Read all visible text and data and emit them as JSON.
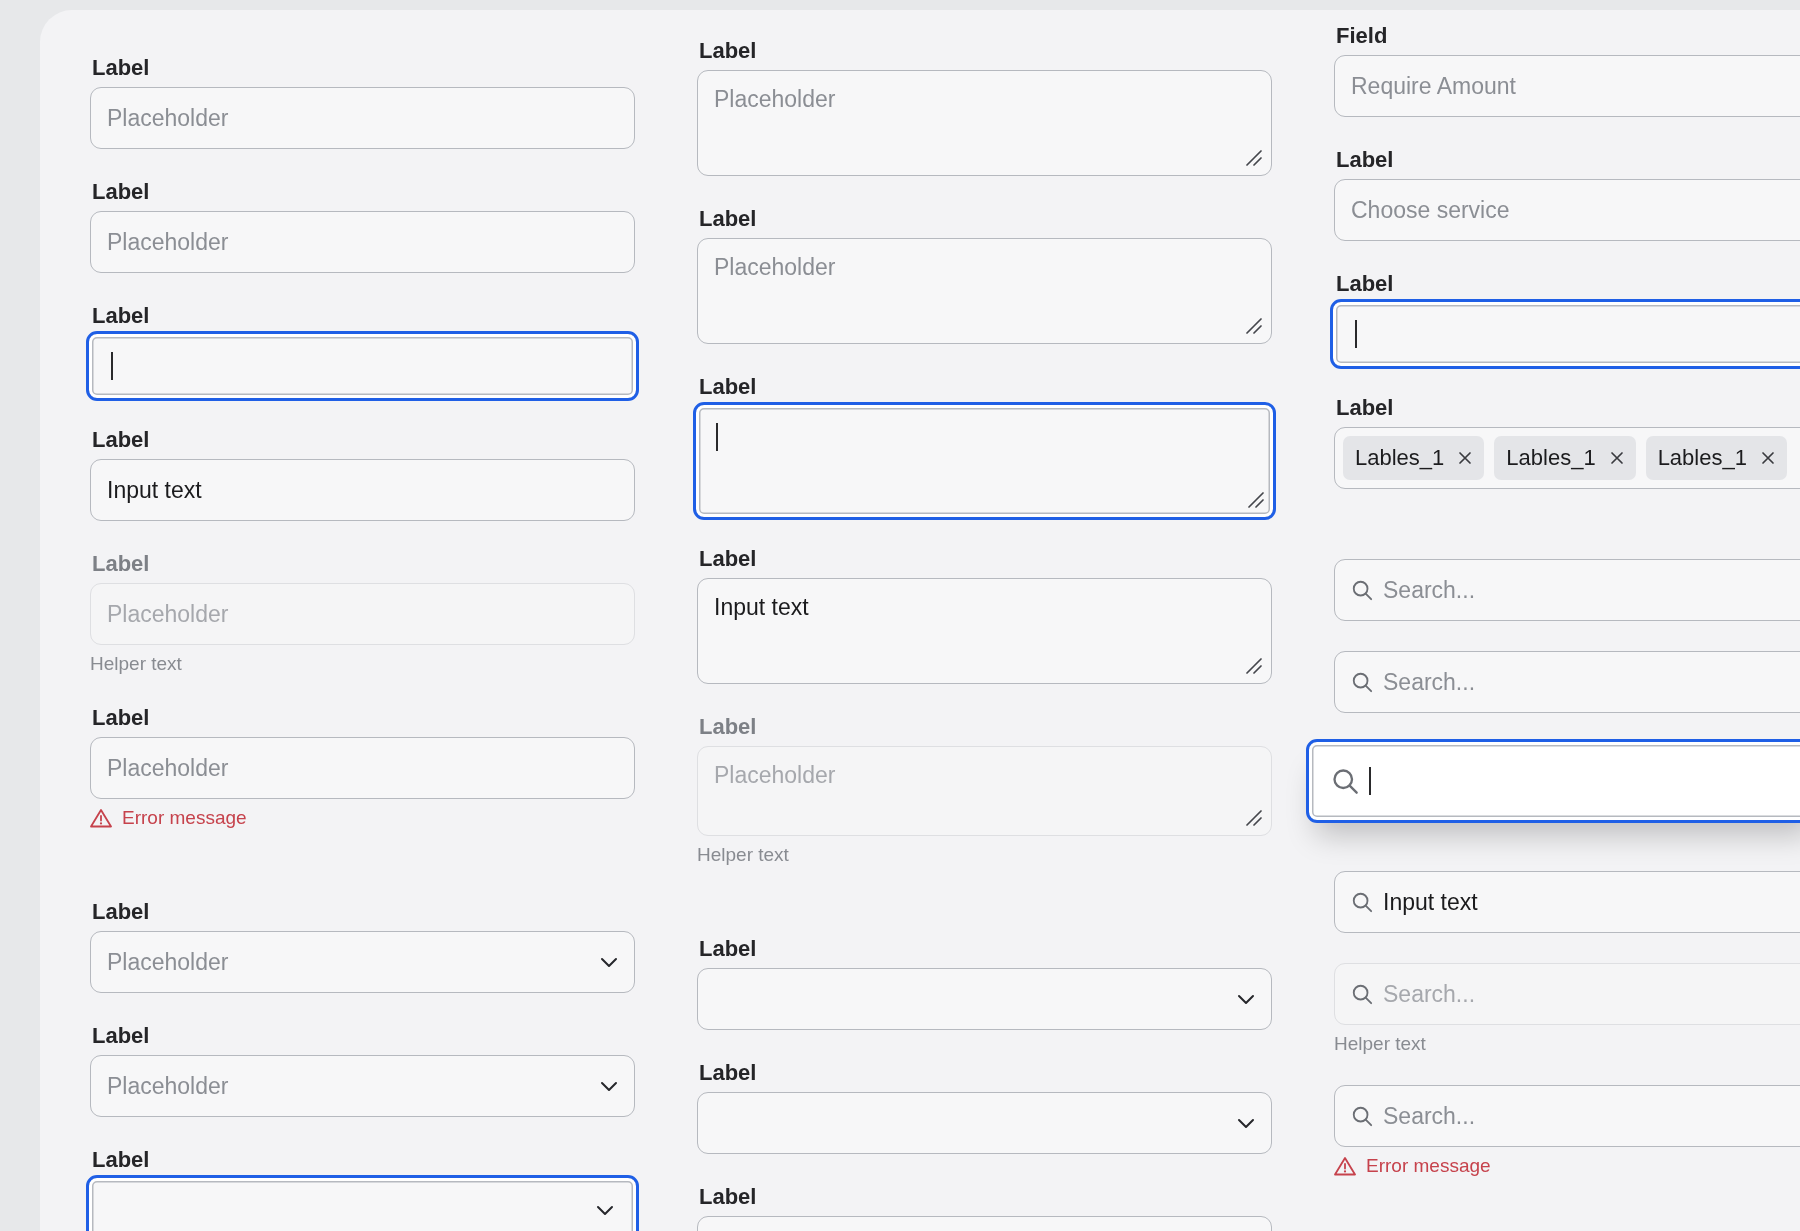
{
  "columns": [
    {
      "sections": [
        {
          "fields": [
            {
              "kind": "input",
              "label": "Label",
              "placeholder": "Placeholder",
              "focused": false,
              "disabled": false
            },
            {
              "kind": "input",
              "label": "Label",
              "placeholder": "Placeholder",
              "focused": false,
              "disabled": false
            },
            {
              "kind": "input",
              "label": "Label",
              "focused": true,
              "disabled": false
            },
            {
              "kind": "input",
              "label": "Label",
              "value": "Input text",
              "focused": false,
              "disabled": false
            },
            {
              "kind": "input",
              "label": "Label",
              "placeholder": "Placeholder",
              "helper_text": "Helper text",
              "focused": false,
              "disabled": true
            },
            {
              "kind": "input",
              "label": "Label",
              "placeholder": "Placeholder",
              "error_message": "Error message",
              "focused": false,
              "disabled": false
            }
          ]
        },
        {
          "fields": [
            {
              "kind": "select",
              "label": "Label",
              "placeholder": "Placeholder",
              "focused": false,
              "disabled": false
            },
            {
              "kind": "select",
              "label": "Label",
              "placeholder": "Placeholder",
              "focused": false,
              "disabled": false
            },
            {
              "kind": "select",
              "label": "Label",
              "focused": true,
              "disabled": false
            }
          ]
        }
      ]
    },
    {
      "sections": [
        {
          "fields": [
            {
              "kind": "textarea",
              "label": "Label",
              "placeholder": "Placeholder",
              "focused": false,
              "disabled": false
            },
            {
              "kind": "textarea",
              "label": "Label",
              "placeholder": "Placeholder",
              "focused": false,
              "disabled": false
            },
            {
              "kind": "textarea",
              "label": "Label",
              "focused": true,
              "disabled": false
            },
            {
              "kind": "textarea",
              "label": "Label",
              "value": "Input text",
              "focused": false,
              "disabled": false
            },
            {
              "kind": "textarea",
              "label": "Label",
              "placeholder": "Placeholder",
              "helper_text": "Helper text",
              "focused": false,
              "disabled": true
            }
          ]
        },
        {
          "fields": [
            {
              "kind": "select",
              "label": "Label",
              "focused": false,
              "disabled": false
            },
            {
              "kind": "select",
              "label": "Label",
              "focused": false,
              "disabled": false
            },
            {
              "kind": "select",
              "label": "Label",
              "focused": false,
              "disabled": false
            }
          ]
        }
      ]
    },
    {
      "sections": [
        {
          "fields": [
            {
              "kind": "input",
              "label": "Field",
              "placeholder": "Require Amount",
              "focused": false,
              "disabled": false
            },
            {
              "kind": "input",
              "label": "Label",
              "placeholder": "Choose service",
              "focused": false,
              "disabled": false
            },
            {
              "kind": "input",
              "label": "Label",
              "focused": true,
              "disabled": false
            },
            {
              "kind": "tags",
              "label": "Label",
              "tags": [
                "Lables_1",
                "Lables_1",
                "Lables_1"
              ],
              "focused": false,
              "disabled": false
            }
          ]
        },
        {
          "fields": [
            {
              "kind": "search",
              "placeholder": "Search...",
              "focused": false,
              "disabled": false
            },
            {
              "kind": "search",
              "placeholder": "Search...",
              "focused": false,
              "disabled": false
            },
            {
              "kind": "search",
              "focused": true,
              "disabled": false
            },
            {
              "kind": "search",
              "value": "Input text",
              "focused": false,
              "disabled": false
            },
            {
              "kind": "search",
              "placeholder": "Search...",
              "helper_text": "Helper text",
              "focused": false,
              "disabled": true
            },
            {
              "kind": "search",
              "placeholder": "Search...",
              "error_message": "Error message",
              "focused": false,
              "disabled": false
            }
          ]
        }
      ]
    }
  ]
}
